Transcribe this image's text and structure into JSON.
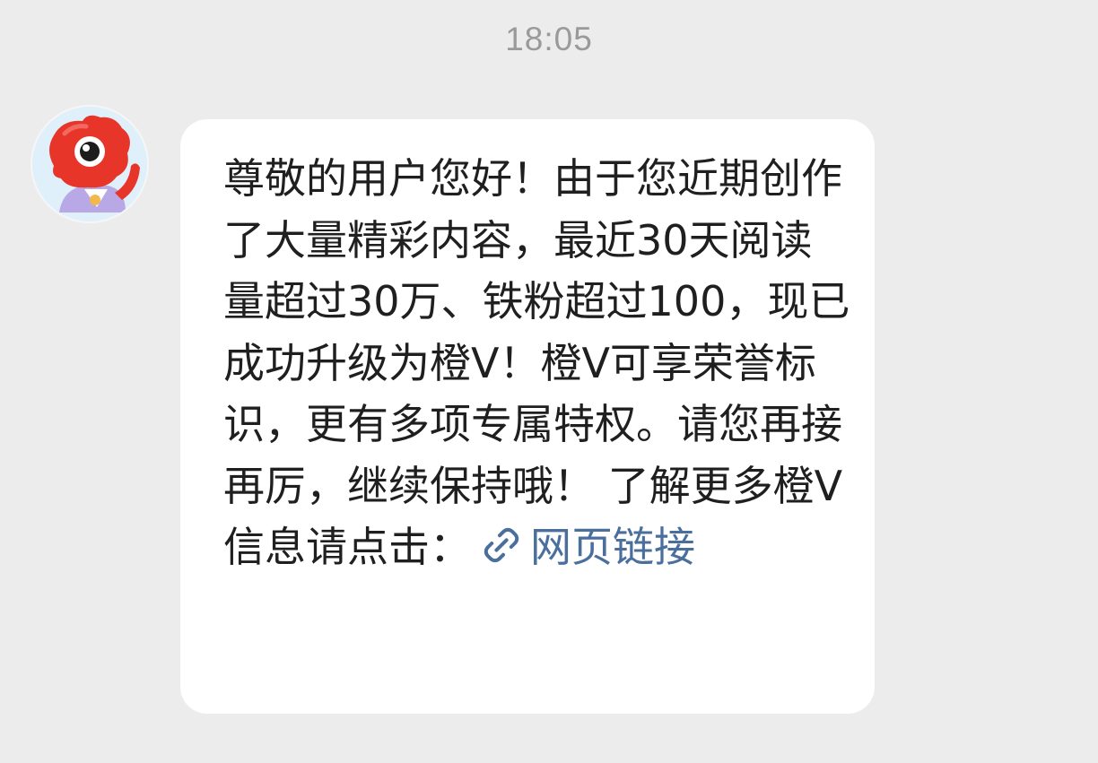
{
  "header": {
    "time": "18:05"
  },
  "message": {
    "sender_avatar": "weibo-mascot-avatar",
    "text": "尊敬的用户您好！由于您近期创作了大量精彩内容，最近30天阅读量超过30万、铁粉超过100，现已成功升级为橙V！橙V可享荣誉标识，更有多项专属特权。请您再接再厉，继续保持哦！ 了解更多橙V信息请点击：",
    "link_icon": "link-icon",
    "link_text": "网页链接"
  },
  "colors": {
    "background": "#ececec",
    "bubble": "#ffffff",
    "text": "#1f1f1f",
    "link": "#4a6f9d",
    "timestamp": "#9a9a9a",
    "avatar_background": "#dff0fb",
    "mascot": "#e8352a"
  }
}
